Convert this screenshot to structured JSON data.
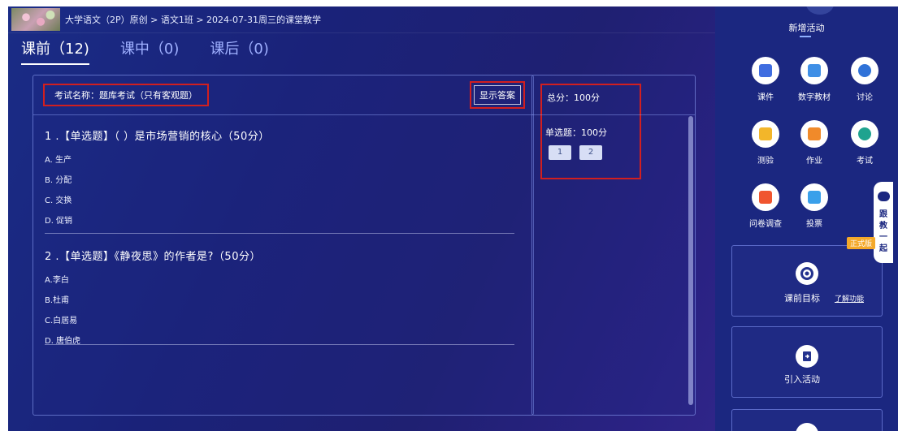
{
  "header": {
    "breadcrumb": "大学语文（2P）原创 > 语文1班 > 2024-07-31周三的课堂教学"
  },
  "tabs": [
    {
      "label": "课前（12)",
      "active": true
    },
    {
      "label": "课中（0)",
      "active": false
    },
    {
      "label": "课后（0)",
      "active": false
    }
  ],
  "exam": {
    "name_label": "考试名称：题库考试（只有客观题）",
    "show_answer": "显示答案",
    "questions": [
      {
        "title": "1 .【单选题】（ ）是市场营销的核心（50分）",
        "options": [
          "A. 生产",
          "B. 分配",
          "C. 交换",
          "D. 促销"
        ]
      },
      {
        "title": "2 .【单选题】《静夜思》的作者是?（50分）",
        "options": [
          "A.李白",
          "B.杜甫",
          "C.白居易",
          "D. 唐伯虎"
        ]
      }
    ]
  },
  "score": {
    "total": "总分：100分",
    "type": "单选题：100分",
    "buttons": [
      "1",
      "2"
    ]
  },
  "sidebar": {
    "title": "新增活动",
    "activities": [
      {
        "label": "课件",
        "icon": "courseware-icon",
        "color": "#3f6de0"
      },
      {
        "label": "数字教材",
        "icon": "digital-textbook-icon",
        "color": "#3f8fe6"
      },
      {
        "label": "讨论",
        "icon": "discussion-icon",
        "color": "#2f72d8"
      },
      {
        "label": "测验",
        "icon": "quiz-icon",
        "color": "#f3b62a"
      },
      {
        "label": "作业",
        "icon": "homework-icon",
        "color": "#f08a2a"
      },
      {
        "label": "考试",
        "icon": "exam-icon",
        "color": "#1fa38f"
      },
      {
        "label": "问卷调查",
        "icon": "survey-icon",
        "color": "#f0552f"
      },
      {
        "label": "投票",
        "icon": "vote-icon",
        "color": "#3aa0ea"
      }
    ],
    "goal_card": {
      "label": "课前目标",
      "link": "了解功能"
    },
    "import_card": {
      "label": "引入活动"
    },
    "official_badge": "正式版",
    "assistant_text": "跟教一起"
  }
}
